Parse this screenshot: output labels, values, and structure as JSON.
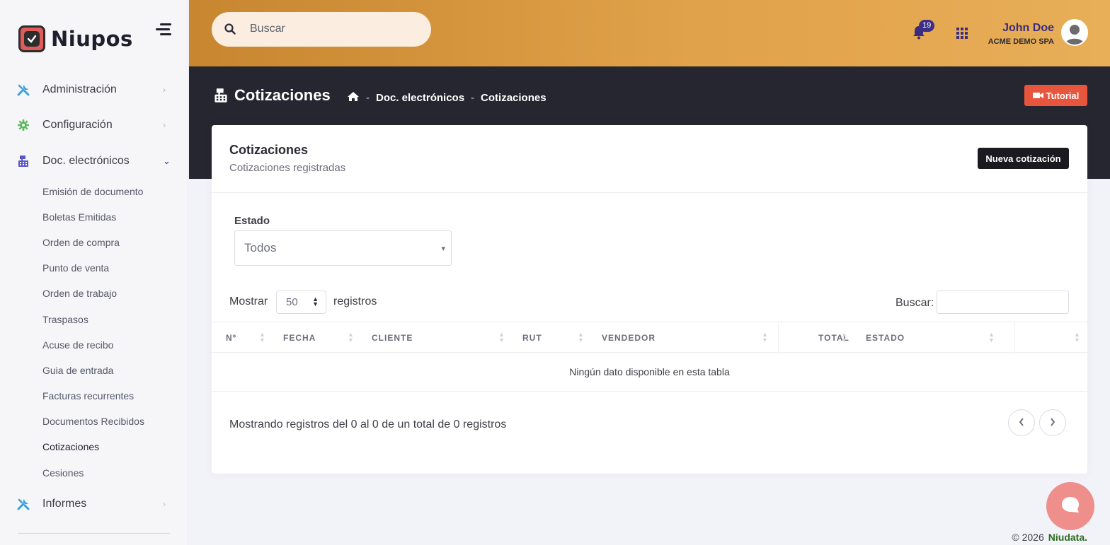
{
  "brand": {
    "name": "Niupos"
  },
  "sidebar": {
    "items": [
      {
        "label": "Administración",
        "icon": "tools-icon"
      },
      {
        "label": "Configuración",
        "icon": "gear-icon"
      },
      {
        "label": "Doc. electrónicos",
        "icon": "cash-register-icon",
        "expanded": true
      },
      {
        "label": "Informes",
        "icon": "tools-icon"
      }
    ],
    "submenu": [
      "Emisión de documento",
      "Boletas Emitidas",
      "Orden de compra",
      "Punto de venta",
      "Orden de trabajo",
      "Traspasos",
      "Acuse de recibo",
      "Guia de entrada",
      "Facturas recurrentes",
      "Documentos Recibidos",
      "Cotizaciones",
      "Cesiones"
    ],
    "active_submenu": "Cotizaciones"
  },
  "topbar": {
    "search_placeholder": "Buscar",
    "notification_count": "19",
    "user_name": "John Doe",
    "company": "ACME DEMO SPA"
  },
  "subheader": {
    "title": "Cotizaciones",
    "breadcrumb": [
      "Doc. electrónicos",
      "Cotizaciones"
    ],
    "tutorial_label": "Tutorial"
  },
  "card": {
    "title": "Cotizaciones",
    "subtitle": "Cotizaciones registradas",
    "new_button": "Nueva cotización",
    "filter_label": "Estado",
    "filter_value": "Todos",
    "show_label": "Mostrar",
    "page_length": "50",
    "records_label": "registros",
    "search_label": "Buscar:",
    "columns": [
      "Nº",
      "FECHA",
      "CLIENTE",
      "RUT",
      "VENDEDOR",
      "TOTAL",
      "ESTADO",
      ""
    ],
    "empty_message": "Ningún dato disponible en esta tabla",
    "info": "Mostrando registros del 0 al 0 de un total de 0 registros"
  },
  "footer": {
    "copyright": "© 2026",
    "company_link": "Niudata."
  },
  "colors": {
    "accent_orange": "#e0a24a",
    "dark_header": "#25262f",
    "tutorial_red": "#e8553d",
    "badge_purple": "#3d2f86",
    "chat_bubble": "#ee8f8c"
  }
}
